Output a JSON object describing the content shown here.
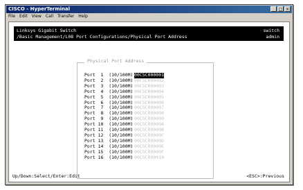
{
  "window": {
    "title": "CISCO - HyperTerminal",
    "buttons": [
      "_",
      "□",
      "×"
    ],
    "menu": [
      "File",
      "Edit",
      "View",
      "Call",
      "Transfer",
      "Help"
    ]
  },
  "terminal": {
    "header_line1": "Linksys Gigabit Switch",
    "header_line2": "/Basic Management/L08 Port Configurations/Physical Port Address",
    "header_right1": "switch",
    "header_right2": "admin",
    "panel_title": "Physical Port Address",
    "ports": [
      {
        "label": "Port  1  (10/100M)",
        "value": "00C5C000001",
        "selected": true
      },
      {
        "label": "Port  2  (10/100M)",
        "value": "00C5C000002",
        "selected": false
      },
      {
        "label": "Port  3  (10/100M)",
        "value": "00C5C000003",
        "selected": false
      },
      {
        "label": "Port  4  (10/100M)",
        "value": "00C5C000004",
        "selected": false
      },
      {
        "label": "Port  5  (10/100M)",
        "value": "00C5C000005",
        "selected": false
      },
      {
        "label": "Port  6  (10/100M)",
        "value": "00C5C000006",
        "selected": false
      },
      {
        "label": "Port  7  (10/100M)",
        "value": "00C5C000007",
        "selected": false
      },
      {
        "label": "Port  8  (10/100M)",
        "value": "00C5C000008",
        "selected": false
      },
      {
        "label": "Port  9  (10/100M)",
        "value": "00C5C000009",
        "selected": false
      },
      {
        "label": "Port 10  (10/100M)",
        "value": "00C5C00000A",
        "selected": false
      },
      {
        "label": "Port 11  (10/100M)",
        "value": "00C5C00000B",
        "selected": false
      },
      {
        "label": "Port 12  (10/100M)",
        "value": "00C5C00000C",
        "selected": false
      },
      {
        "label": "Port 13  (10/100M)",
        "value": "00C5C00000D",
        "selected": false
      },
      {
        "label": "Port 14  (10/100M)",
        "value": "00C5C00000E",
        "selected": false
      },
      {
        "label": "Port 15  (10/100M)",
        "value": "00C5C00000F",
        "selected": false
      },
      {
        "label": "Port 16  (10/100M)",
        "value": "00C5C000010",
        "selected": false
      }
    ],
    "status_left": "Up/Down:Select/Enter:Edit",
    "status_right": "<ESC>:Previous"
  }
}
